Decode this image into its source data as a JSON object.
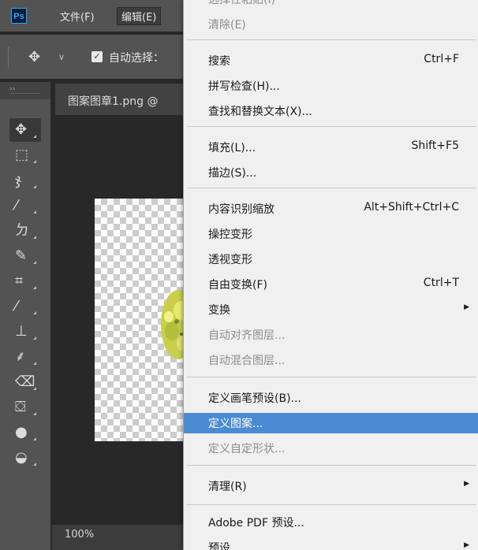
{
  "menubar": {
    "logo": "Ps",
    "items": [
      {
        "label": "文件(F)"
      },
      {
        "label": "编辑(E)"
      }
    ]
  },
  "options_bar": {
    "auto_select_label": "自动选择：",
    "checkbox_checked": true
  },
  "document": {
    "tab_title": "图案图章1.png @",
    "zoom": "100%"
  },
  "toolbar": {
    "collapse_glyph": "››",
    "tools": [
      {
        "name": "move-tool-icon",
        "glyph": "✥"
      },
      {
        "name": "marquee-tool-icon",
        "glyph": "⬚"
      },
      {
        "name": "lasso-tool-icon",
        "glyph": "ჯ"
      },
      {
        "name": "magic-wand-tool-icon",
        "glyph": "⁄"
      },
      {
        "name": "crop-tool-icon",
        "glyph": "ㄉ"
      },
      {
        "name": "eyedropper-tool-icon",
        "glyph": "✎"
      },
      {
        "name": "frame-tool-icon",
        "glyph": "⌗"
      },
      {
        "name": "brush-tool-icon",
        "glyph": "⁄"
      },
      {
        "name": "stamp-tool-icon",
        "glyph": "⊥"
      },
      {
        "name": "history-brush-tool-icon",
        "glyph": "⸙"
      },
      {
        "name": "eraser-tool-icon",
        "glyph": "⌫"
      },
      {
        "name": "paint-bucket-tool-icon",
        "glyph": "⛋"
      },
      {
        "name": "blur-tool-icon",
        "glyph": "●"
      },
      {
        "name": "dodge-tool-icon",
        "glyph": "◒"
      }
    ]
  },
  "edit_menu": {
    "items": [
      {
        "label": "选择性粘贴(I)",
        "shortcut": "",
        "submenu": true,
        "disabled": true
      },
      {
        "label": "清除(E)",
        "shortcut": "",
        "submenu": false,
        "disabled": true
      },
      {
        "label": "搜索",
        "shortcut": "Ctrl+F",
        "submenu": false,
        "disabled": false
      },
      {
        "label": "拼写检查(H)...",
        "shortcut": "",
        "submenu": false,
        "disabled": false
      },
      {
        "label": "查找和替换文本(X)...",
        "shortcut": "",
        "submenu": false,
        "disabled": false
      },
      {
        "label": "填充(L)...",
        "shortcut": "Shift+F5",
        "submenu": false,
        "disabled": false
      },
      {
        "label": "描边(S)...",
        "shortcut": "",
        "submenu": false,
        "disabled": false
      },
      {
        "label": "内容识别缩放",
        "shortcut": "Alt+Shift+Ctrl+C",
        "submenu": false,
        "disabled": false
      },
      {
        "label": "操控变形",
        "shortcut": "",
        "submenu": false,
        "disabled": false
      },
      {
        "label": "透视变形",
        "shortcut": "",
        "submenu": false,
        "disabled": false
      },
      {
        "label": "自由变换(F)",
        "shortcut": "Ctrl+T",
        "submenu": false,
        "disabled": false
      },
      {
        "label": "变换",
        "shortcut": "",
        "submenu": true,
        "disabled": false
      },
      {
        "label": "自动对齐图层...",
        "shortcut": "",
        "submenu": false,
        "disabled": true
      },
      {
        "label": "自动混合图层...",
        "shortcut": "",
        "submenu": false,
        "disabled": true
      },
      {
        "label": "定义画笔预设(B)...",
        "shortcut": "",
        "submenu": false,
        "disabled": false
      },
      {
        "label": "定义图案...",
        "shortcut": "",
        "submenu": false,
        "disabled": false,
        "highlighted": true
      },
      {
        "label": "定义自定形状...",
        "shortcut": "",
        "submenu": false,
        "disabled": true
      },
      {
        "label": "清理(R)",
        "shortcut": "",
        "submenu": true,
        "disabled": false
      },
      {
        "label": "Adobe PDF 预设...",
        "shortcut": "",
        "submenu": false,
        "disabled": false
      },
      {
        "label": "预设",
        "shortcut": "",
        "submenu": true,
        "disabled": false
      }
    ]
  },
  "colors": {
    "highlight": "#4a8bd3",
    "menu_bg": "#f0f0f0",
    "app_bg": "#535353"
  }
}
